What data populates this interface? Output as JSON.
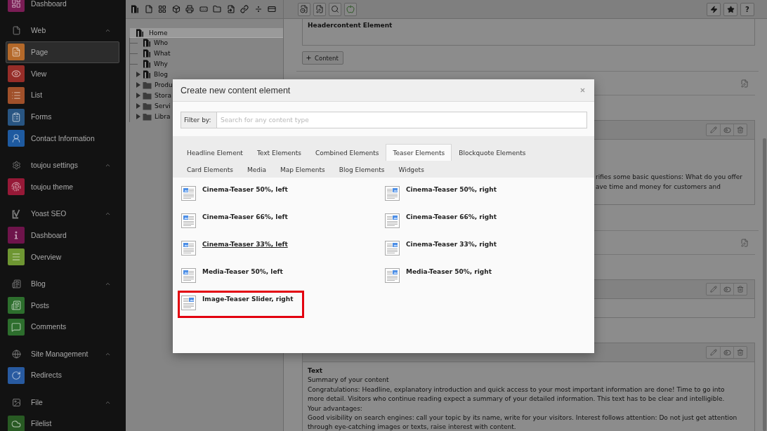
{
  "sidebar": {
    "top_item": {
      "label": "Dashboard",
      "color": "#7a1d55"
    },
    "groups": [
      {
        "label": "Web",
        "expanded": true,
        "items": [
          {
            "label": "Page",
            "selected": true,
            "color": "#b4692a"
          },
          {
            "label": "View",
            "selected": false,
            "color": "#962d28"
          },
          {
            "label": "List",
            "selected": false,
            "color": "#a0502a"
          },
          {
            "label": "Forms",
            "selected": false,
            "color": "#285582"
          },
          {
            "label": "Contact Information",
            "selected": false,
            "color": "#1e5aa0"
          }
        ]
      },
      {
        "label": "toujou settings",
        "expanded": true,
        "items": [
          {
            "label": "toujou theme",
            "selected": false,
            "color": "#961937"
          }
        ]
      },
      {
        "label": "Yoast SEO",
        "expanded": true,
        "items": [
          {
            "label": "Dashboard",
            "selected": false,
            "color": "#6e144b"
          },
          {
            "label": "Overview",
            "selected": false,
            "color": "#6e9632"
          }
        ]
      },
      {
        "label": "Blog",
        "expanded": true,
        "items": [
          {
            "label": "Posts",
            "selected": false,
            "color": "#2d6e2d"
          },
          {
            "label": "Comments",
            "selected": false,
            "color": "#2d6e2d"
          }
        ]
      },
      {
        "label": "Site Management",
        "expanded": true,
        "items": [
          {
            "label": "Redirects",
            "selected": false,
            "color": "#285aa0"
          }
        ]
      },
      {
        "label": "File",
        "expanded": true,
        "items": [
          {
            "label": "Filelist",
            "selected": false,
            "color": "#285a23"
          }
        ]
      }
    ]
  },
  "page_tree": {
    "items": [
      {
        "label": "Home",
        "kind": "page",
        "selected": true,
        "expandable": false,
        "children": [
          {
            "label": "Who",
            "kind": "page",
            "selected": false,
            "expandable": false
          },
          {
            "label": "What",
            "kind": "page",
            "selected": false,
            "expandable": false
          },
          {
            "label": "Why",
            "kind": "page",
            "selected": false,
            "expandable": false
          },
          {
            "label": "Blog",
            "kind": "page",
            "selected": false,
            "expandable": true
          },
          {
            "label": "Produ",
            "kind": "folder",
            "selected": false,
            "expandable": true
          },
          {
            "label": "Stora",
            "kind": "folder",
            "selected": false,
            "expandable": true
          },
          {
            "label": "Servi",
            "kind": "folder",
            "selected": false,
            "expandable": true
          },
          {
            "label": "Libra",
            "kind": "folder",
            "selected": false,
            "expandable": true
          }
        ]
      }
    ]
  },
  "toolbar": {
    "help_label": "?"
  },
  "content": {
    "header_element": {
      "title": "Headercontent Element"
    },
    "add_button": {
      "label": "Content"
    },
    "sections": [
      {
        "cards": [
          {
            "kind": "fragment",
            "lines": [
              "rifies some basic questions: What do you offer",
              "ave time and money for customers and"
            ]
          }
        ]
      },
      {
        "cards": [
          {
            "kind": "blank"
          },
          {
            "kind": "text",
            "title": "Text",
            "lines": [
              "Summary of your content",
              "Congratulations: Headline, explanatory introduction and quick access to your most important information are done! Time to go into more detail. Visitors who continue reading expect a summary of your detailed information. This text has to be clear and intelligible.",
              "Your advantages:",
              "Good visibility on search engines: call your topic by its name, write for your visitors. Interest follows attention: Do not just get attention through eye-catching images or texts, raise interest with content."
            ]
          }
        ]
      }
    ]
  },
  "modal": {
    "title": "Create new content element",
    "filter": {
      "label": "Filter by:",
      "placeholder": "Search for any content type"
    },
    "tabs": [
      {
        "label": "Headline Element",
        "selected": false
      },
      {
        "label": "Text Elements",
        "selected": false
      },
      {
        "label": "Combined Elements",
        "selected": false
      },
      {
        "label": "Teaser Elements",
        "selected": true
      },
      {
        "label": "Blockquote Elements",
        "selected": false
      },
      {
        "label": "Card Elements",
        "selected": false
      },
      {
        "label": "Media",
        "selected": false
      },
      {
        "label": "Map Elements",
        "selected": false
      },
      {
        "label": "Blog Elements",
        "selected": false
      },
      {
        "label": "Widgets",
        "selected": false
      }
    ],
    "items": [
      {
        "label": "Cinema-Teaser 50%, left",
        "kind": "left",
        "hovered": false,
        "highlighted": false
      },
      {
        "label": "Cinema-Teaser 50%, right",
        "kind": "right",
        "hovered": false,
        "highlighted": false
      },
      {
        "label": "Cinema-Teaser 66%, left",
        "kind": "left",
        "hovered": false,
        "highlighted": false
      },
      {
        "label": "Cinema-Teaser 66%, right",
        "kind": "right",
        "hovered": false,
        "highlighted": false
      },
      {
        "label": "Cinema-Teaser 33%, left",
        "kind": "left",
        "hovered": true,
        "highlighted": false
      },
      {
        "label": "Cinema-Teaser 33%, right",
        "kind": "right",
        "hovered": false,
        "highlighted": false
      },
      {
        "label": "Media-Teaser 50%, left",
        "kind": "left",
        "hovered": false,
        "highlighted": false
      },
      {
        "label": "Media-Teaser 50%, right",
        "kind": "right",
        "hovered": false,
        "highlighted": false
      },
      {
        "label": "Image-Teaser Slider, right",
        "kind": "right",
        "hovered": false,
        "highlighted": true
      }
    ]
  }
}
